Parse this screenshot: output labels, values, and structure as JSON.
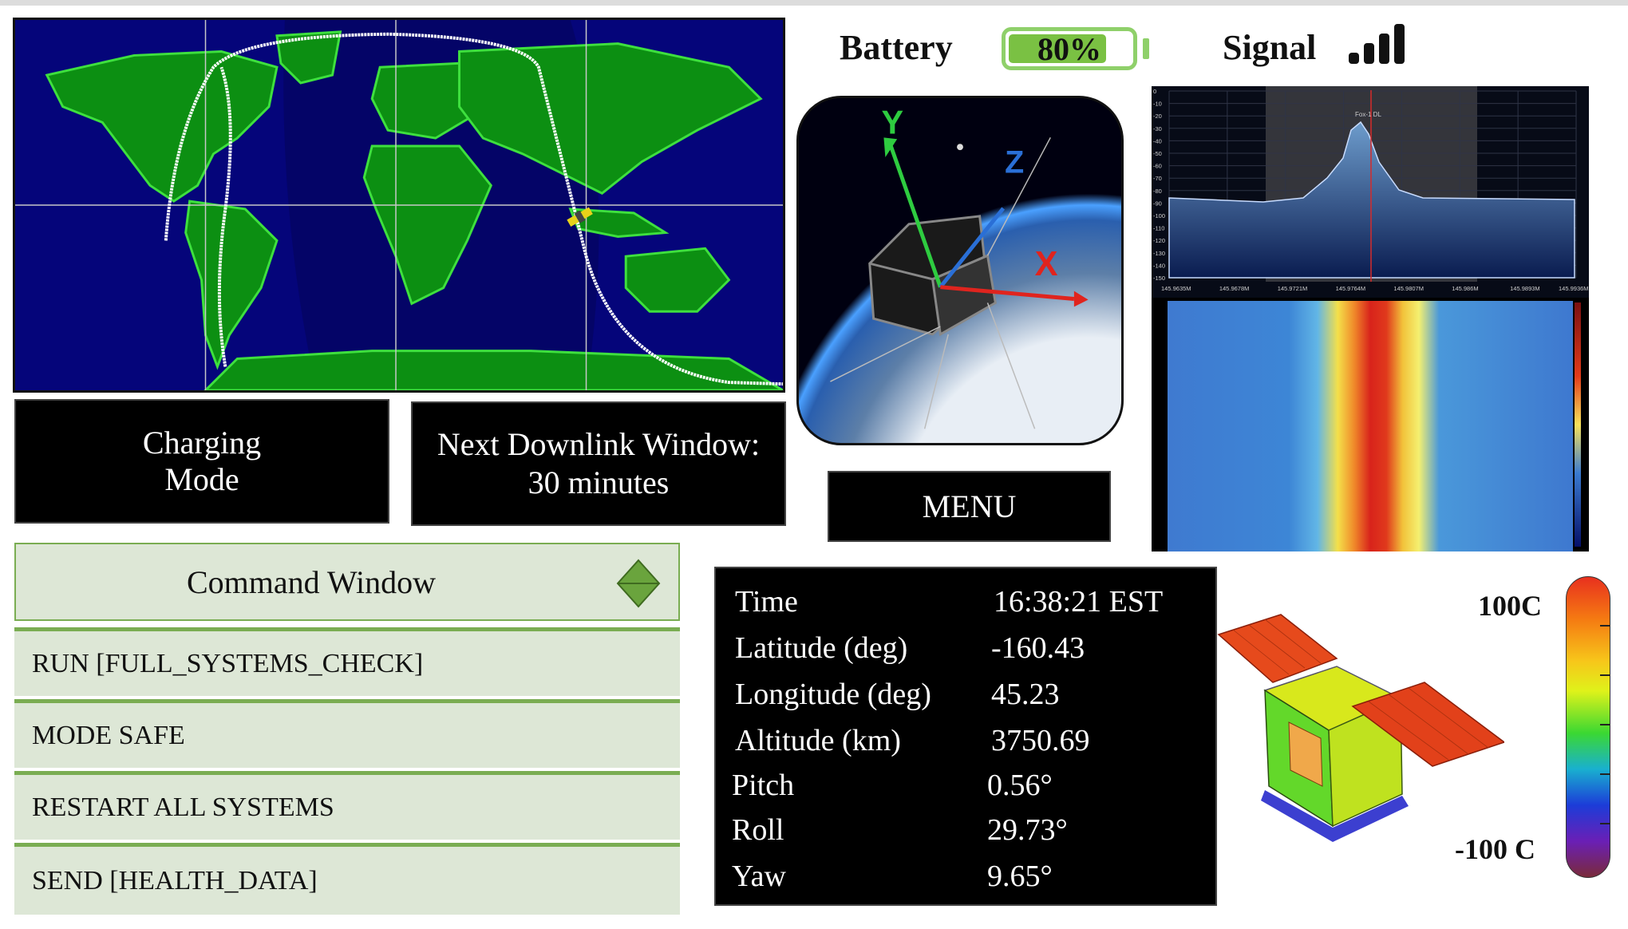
{
  "header": {
    "battery_label": "Battery",
    "battery_level": 0.8,
    "battery_text": "80%",
    "signal_label": "Signal",
    "signal_bars_filled": 4,
    "signal_bars_total": 4
  },
  "status": {
    "mode_line1": "Charging",
    "mode_line2": "Mode",
    "downlink_line1": "Next Downlink Window:",
    "downlink_line2": "30 minutes"
  },
  "menu": {
    "label": "MENU"
  },
  "attitude_view": {
    "axes": [
      "Y",
      "Z",
      "X"
    ]
  },
  "command_window": {
    "title": "Command Window",
    "items": [
      {
        "label": "RUN [FULL_SYSTEMS_CHECK]"
      },
      {
        "label": "MODE SAFE"
      },
      {
        "label": "RESTART ALL SYSTEMS"
      },
      {
        "label": "SEND [HEALTH_DATA]"
      }
    ]
  },
  "telemetry": [
    {
      "label": "Time",
      "value": "16:38:21 EST"
    },
    {
      "label": "Latitude (deg)",
      "value": "-160.43"
    },
    {
      "label": "Longitude (deg)",
      "value": "45.23"
    },
    {
      "label": "Altitude (km)",
      "value": "3750.69"
    },
    {
      "label": "Pitch",
      "value": "0.56°"
    },
    {
      "label": "Roll",
      "value": "29.73°"
    },
    {
      "label": "Yaw",
      "value": "9.65°"
    }
  ],
  "spectrum": {
    "signal_name": "Fox-1 DL",
    "y_ticks": [
      "0",
      "-10",
      "-20",
      "-30",
      "-40",
      "-50",
      "-60",
      "-70",
      "-80",
      "-90",
      "-100",
      "-110",
      "-120",
      "-130",
      "-140",
      "-150"
    ],
    "x_ticks": [
      "145.9635M",
      "145.9678M",
      "145.9721M",
      "145.9764M",
      "145.9807M",
      "145.986M",
      "145.9893M",
      "145.9936M"
    ]
  },
  "thermal": {
    "max_label": "100C",
    "min_label": "-100 C"
  },
  "colors": {
    "accent_green": "#7ac143",
    "command_bg": "#dde7d6",
    "map_ocean": "#05057a",
    "map_land": "#0a8a0a",
    "panel_black": "#000000"
  }
}
